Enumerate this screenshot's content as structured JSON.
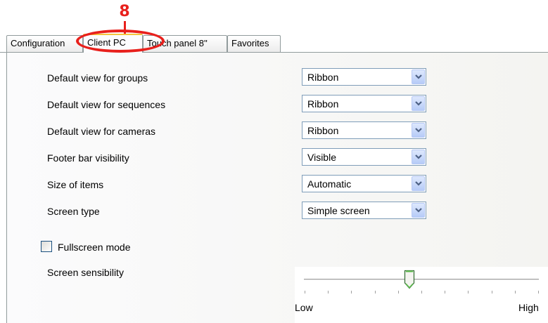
{
  "callout": {
    "number": "8"
  },
  "tabs": [
    {
      "label": "Configuration",
      "active": false
    },
    {
      "label": "Client PC",
      "active": true
    },
    {
      "label": "Touch panel 8''",
      "active": false
    },
    {
      "label": "Favorites",
      "active": false
    }
  ],
  "settings": [
    {
      "label": "Default view for groups",
      "value": "Ribbon"
    },
    {
      "label": "Default view for sequences",
      "value": "Ribbon"
    },
    {
      "label": "Default view for cameras",
      "value": "Ribbon"
    },
    {
      "label": "Footer bar visibility",
      "value": "Visible"
    },
    {
      "label": "Size of items",
      "value": "Automatic"
    },
    {
      "label": "Screen type",
      "value": "Simple screen"
    }
  ],
  "fullscreen": {
    "label": "Fullscreen mode",
    "checked": false
  },
  "sensibility": {
    "label": "Screen sensibility",
    "min_label": "Low",
    "max_label": "High",
    "level_fraction": 0.45,
    "tick_count": 11
  },
  "colors": {
    "callout": "#e8201c",
    "active_tab_accent": "#f4c53d"
  }
}
